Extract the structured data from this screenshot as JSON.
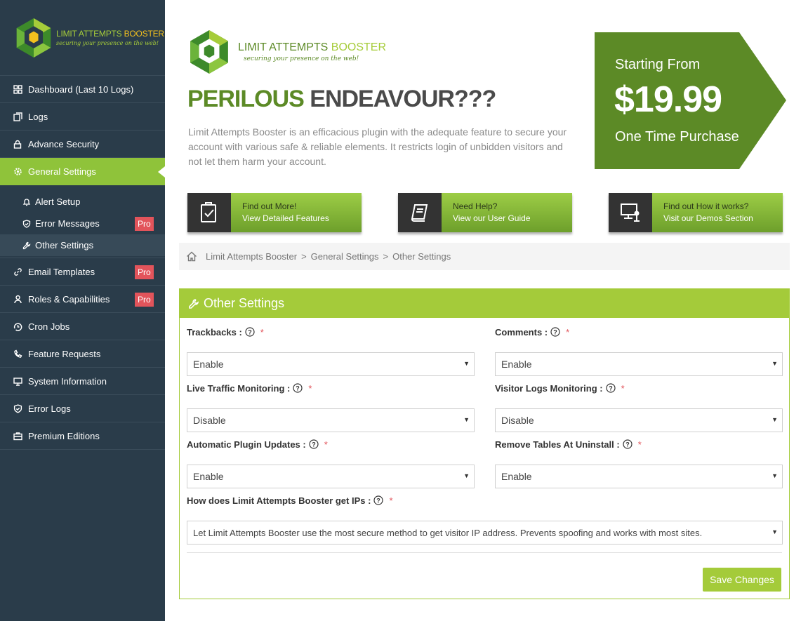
{
  "sidebar": {
    "logo_title_a": "LIMIT ATTEMPTS",
    "logo_title_b": "BOOSTER",
    "logo_tagline": "securing your presence on the web!",
    "items": [
      {
        "label": "Dashboard (Last 10 Logs)",
        "icon": "dashboard-icon"
      },
      {
        "label": "Logs",
        "icon": "logs-icon"
      },
      {
        "label": "Advance Security",
        "icon": "lock-icon"
      },
      {
        "label": "General Settings",
        "icon": "gear-icon"
      }
    ],
    "subitems": [
      {
        "label": "Alert Setup",
        "icon": "bell-icon"
      },
      {
        "label": "Error Messages",
        "icon": "shield-icon",
        "badge": "Pro"
      },
      {
        "label": "Other Settings",
        "icon": "wrench-icon"
      }
    ],
    "items_after": [
      {
        "label": "Email Templates",
        "icon": "link-icon",
        "badge": "Pro"
      },
      {
        "label": "Roles & Capabilities",
        "icon": "users-icon",
        "badge": "Pro"
      },
      {
        "label": "Cron Jobs",
        "icon": "clock-icon"
      },
      {
        "label": "Feature Requests",
        "icon": "phone-icon"
      },
      {
        "label": "System Information",
        "icon": "monitor-icon"
      },
      {
        "label": "Error Logs",
        "icon": "shield-icon"
      },
      {
        "label": "Premium Editions",
        "icon": "briefcase-icon"
      }
    ]
  },
  "banner": {
    "logo_title_a": "LIMIT ATTEMPTS",
    "logo_title_b": "BOOSTER",
    "logo_tagline": "securing your presence on the web!",
    "headline_a": "PERILOUS",
    "headline_b": "ENDEAVOUR???",
    "description": "Limit Attempts Booster is an efficacious plugin with the adequate feature to secure your account with various safe & reliable elements. It restricts login of unbidden visitors and not let them harm your account.",
    "price_pre": "Starting From",
    "price": "$19.99",
    "price_post": "One Time Purchase",
    "price_color": "#5c8a26"
  },
  "ctas": [
    {
      "line1": "Find out More!",
      "line2": "View Detailed Features",
      "icon": "checklist-icon"
    },
    {
      "line1": "Need Help?",
      "line2": "View our User Guide",
      "icon": "book-icon"
    },
    {
      "line1": "Find out How it works?",
      "line2": "Visit our Demos Section",
      "icon": "presentation-icon"
    }
  ],
  "breadcrumb": [
    "Limit Attempts Booster",
    "General Settings",
    "Other Settings"
  ],
  "panel": {
    "title": "Other Settings",
    "fields": {
      "trackbacks": {
        "label": "Trackbacks :",
        "value": "Enable"
      },
      "comments": {
        "label": "Comments :",
        "value": "Enable"
      },
      "live_traffic": {
        "label": "Live Traffic Monitoring :",
        "value": "Disable"
      },
      "visitor_logs": {
        "label": "Visitor Logs Monitoring :",
        "value": "Disable"
      },
      "auto_updates": {
        "label": "Automatic Plugin Updates :",
        "value": "Enable"
      },
      "remove_tables": {
        "label": "Remove Tables At Uninstall :",
        "value": "Enable"
      },
      "ip_method": {
        "label": "How does Limit Attempts Booster get IPs :",
        "value": "Let Limit Attempts Booster use the most secure method to get visitor IP address. Prevents spoofing and works with most sites."
      }
    },
    "required_mark": "*",
    "save_label": "Save Changes"
  },
  "colors": {
    "sidebar_bg": "#2a3c4a",
    "accent": "#a4cb3a",
    "pro_badge": "#e2545b",
    "dark_green": "#5c8a26"
  }
}
